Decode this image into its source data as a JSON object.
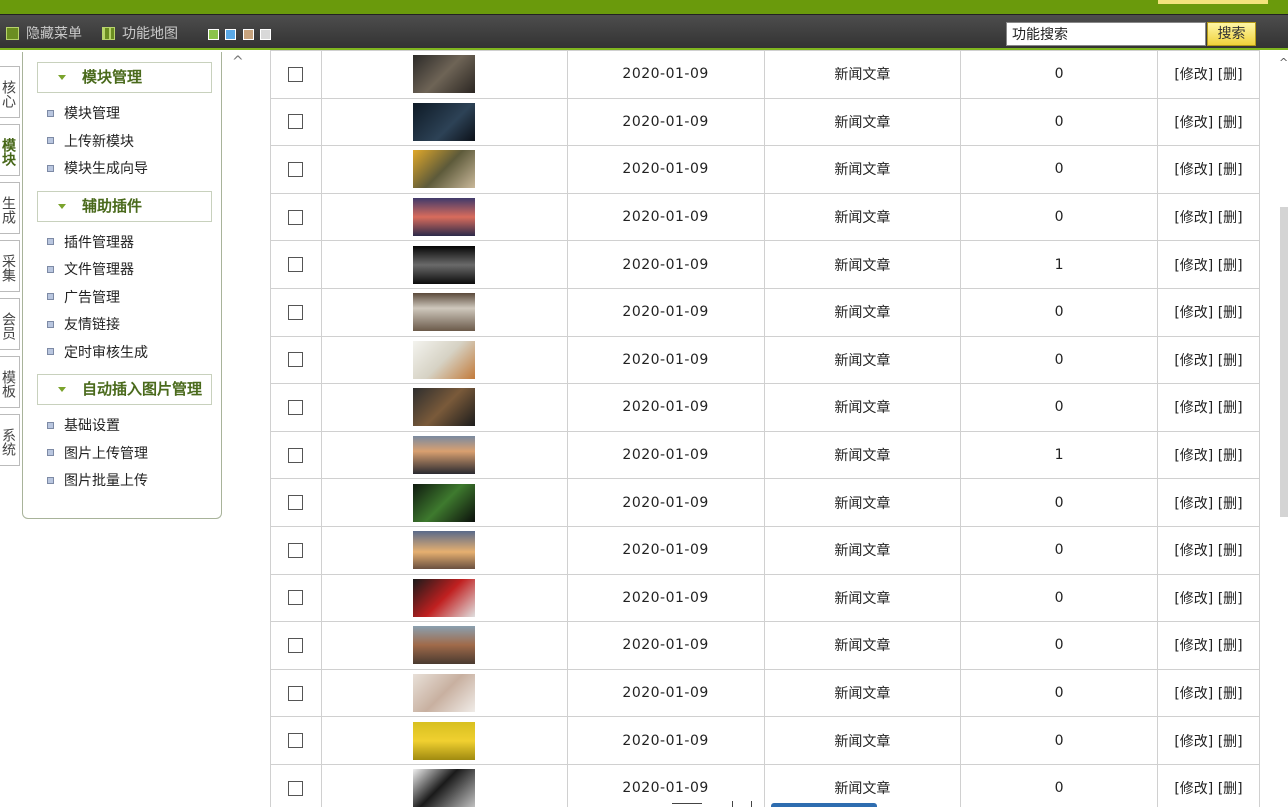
{
  "toolbar": {
    "hide_menu": "隐藏菜单",
    "function_map": "功能地图",
    "search_value": "功能搜索",
    "search_button": "搜索",
    "theme_colors": [
      "#8bc34a",
      "#5aa9e6",
      "#c8a47e",
      "#d9d9d9"
    ]
  },
  "vtabs": [
    {
      "label": "核心",
      "active": false
    },
    {
      "label": "模块",
      "active": true
    },
    {
      "label": "生成",
      "active": false
    },
    {
      "label": "采集",
      "active": false
    },
    {
      "label": "会员",
      "active": false
    },
    {
      "label": "模板",
      "active": false
    },
    {
      "label": "系统",
      "active": false
    }
  ],
  "menu": {
    "sections": [
      {
        "title": "模块管理",
        "items": [
          "模块管理",
          "上传新模块",
          "模块生成向导"
        ]
      },
      {
        "title": "辅助插件",
        "items": [
          "插件管理器",
          "文件管理器",
          "广告管理",
          "友情链接",
          "定时审核生成"
        ]
      },
      {
        "title": "自动插入图片管理",
        "items": [
          "基础设置",
          "图片上传管理",
          "图片批量上传"
        ]
      }
    ]
  },
  "table": {
    "ops": {
      "edit": "[修改]",
      "delete": "[删]"
    },
    "rows": [
      {
        "date": "2020-01-09",
        "type": "新闻文章",
        "count": "0",
        "thumb": "shoes-on-wood"
      },
      {
        "date": "2020-01-09",
        "type": "新闻文章",
        "count": "0",
        "thumb": "person-in-dark-water"
      },
      {
        "date": "2020-01-09",
        "type": "新闻文章",
        "count": "0",
        "thumb": "sunflowers-on-table"
      },
      {
        "date": "2020-01-09",
        "type": "新闻文章",
        "count": "0",
        "thumb": "pier-at-sunset"
      },
      {
        "date": "2020-01-09",
        "type": "新闻文章",
        "count": "1",
        "thumb": "night-bridge-lights"
      },
      {
        "date": "2020-01-09",
        "type": "新闻文章",
        "count": "0",
        "thumb": "danger-sign"
      },
      {
        "date": "2020-01-09",
        "type": "新闻文章",
        "count": "0",
        "thumb": "colored-pencils"
      },
      {
        "date": "2020-01-09",
        "type": "新闻文章",
        "count": "0",
        "thumb": "eagle"
      },
      {
        "date": "2020-01-09",
        "type": "新闻文章",
        "count": "1",
        "thumb": "lake-at-dusk"
      },
      {
        "date": "2020-01-09",
        "type": "新闻文章",
        "count": "0",
        "thumb": "green-bowl"
      },
      {
        "date": "2020-01-09",
        "type": "新闻文章",
        "count": "0",
        "thumb": "desert-sunset"
      },
      {
        "date": "2020-01-09",
        "type": "新闻文章",
        "count": "0",
        "thumb": "red-car"
      },
      {
        "date": "2020-01-09",
        "type": "新闻文章",
        "count": "0",
        "thumb": "canal-city"
      },
      {
        "date": "2020-01-09",
        "type": "新闻文章",
        "count": "0",
        "thumb": "bride-flowers"
      },
      {
        "date": "2020-01-09",
        "type": "新闻文章",
        "count": "0",
        "thumb": "yellow-tulips"
      },
      {
        "date": "2020-01-09",
        "type": "新闻文章",
        "count": "0",
        "thumb": "phone-chart"
      }
    ]
  }
}
